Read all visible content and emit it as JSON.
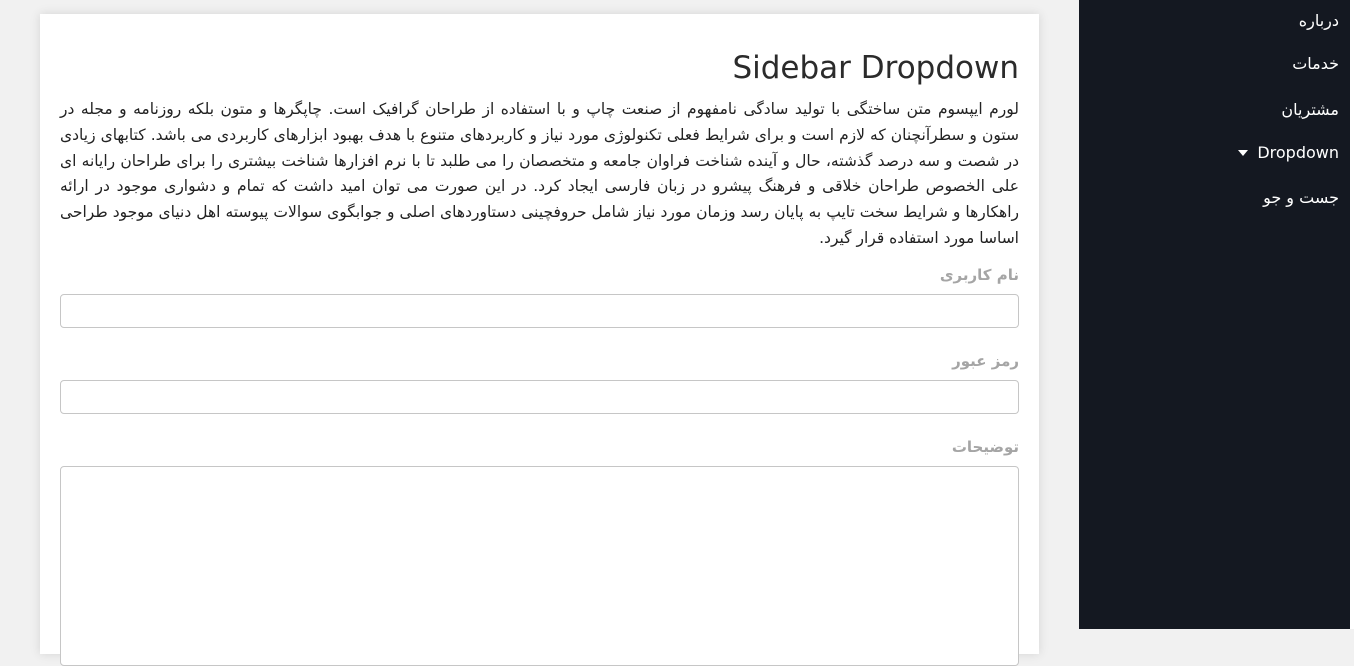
{
  "main": {
    "title": "Sidebar Dropdown",
    "intro": "لورم ایپسوم متن ساختگی با تولید سادگی نامفهوم از صنعت چاپ و با استفاده از طراحان گرافیک است. چاپگرها و متون بلکه روزنامه و مجله در ستون و سطرآنچنان که لازم است و برای شرایط فعلی تکنولوژی مورد نیاز و کاربردهای متنوع با هدف بهبود ابزارهای کاربردی می باشد. کتابهای زیادی در شصت و سه درصد گذشته، حال و آینده شناخت فراوان جامعه و متخصصان را می طلبد تا با نرم افزارها شناخت بیشتری را برای طراحان رایانه ای علی الخصوص طراحان خلاقی و فرهنگ پیشرو در زبان فارسی ایجاد کرد. در این صورت می توان امید داشت که تمام و دشواری موجود در ارائه راهکارها و شرایط سخت تایپ به پایان رسد وزمان مورد نیاز شامل حروفچینی دستاوردهای اصلی و جوابگوی سوالات پیوسته اهل دنیای موجود طراحی اساسا مورد استفاده قرار گیرد.",
    "form": {
      "username_label": "نام کاربری",
      "username_value": "",
      "password_label": "رمز عبور",
      "password_value": "",
      "description_label": "توضیحات",
      "description_value": ""
    }
  },
  "sidebar": {
    "items": [
      {
        "label": "درباره"
      },
      {
        "label": "خدمات"
      },
      {
        "label": "مشتریان"
      },
      {
        "label": "Dropdown",
        "icon": "caret-down-icon"
      },
      {
        "label": "جست و جو"
      }
    ]
  },
  "colors": {
    "sidebar_bg": "#141821",
    "page_bg": "#f1f1f1",
    "label_gray": "#a5a5a5"
  }
}
